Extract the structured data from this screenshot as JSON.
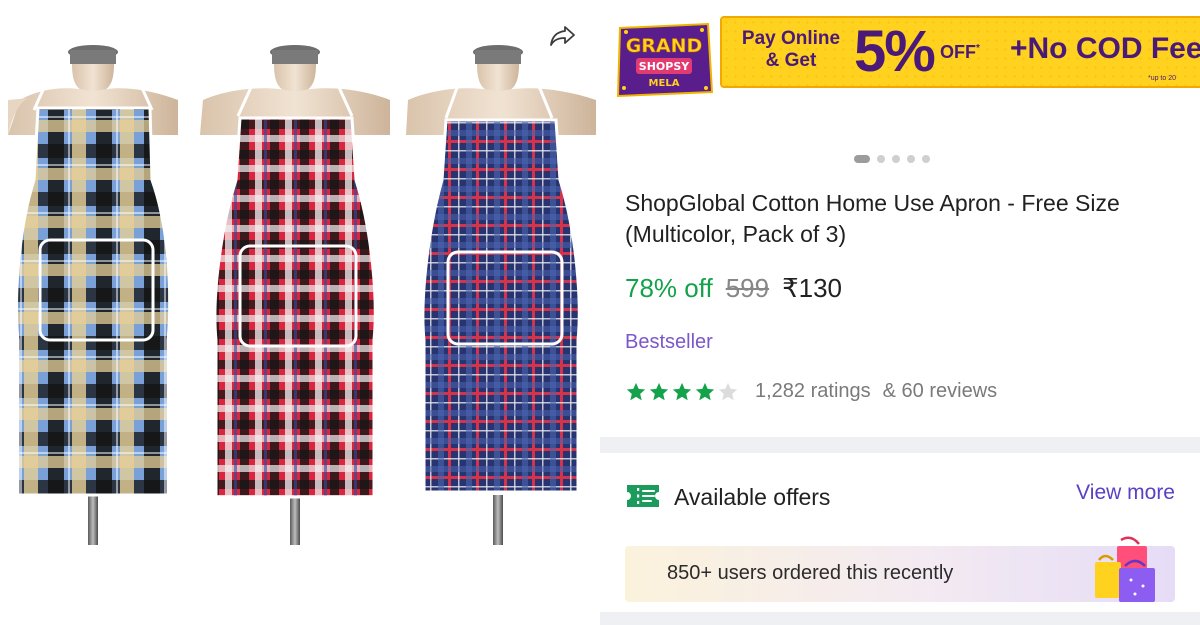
{
  "promo": {
    "logo_line1": "GRAND",
    "logo_line2": "SHOPSY",
    "logo_line3": "MELA",
    "pay_line1": "Pay Online",
    "pay_line2": "& Get",
    "percent": "5%",
    "off": "OFF",
    "off_mark": "*",
    "cod": "+No COD Fee",
    "upto": "*up to 20"
  },
  "carousel": {
    "total": 5,
    "active_index": 0
  },
  "product": {
    "title": "ShopGlobal Cotton Home Use Apron - Free Size (Multicolor, Pack of 3)",
    "discount": "78% off",
    "mrp": "599",
    "price": "₹130",
    "badge": "Bestseller",
    "rating": 4,
    "rating_max": 5,
    "ratings_count": "1,282 ratings",
    "reviews_count": "& 60 reviews"
  },
  "offers": {
    "label": "Available offers",
    "view_more": "View more"
  },
  "social_proof": {
    "text": "850+ users ordered this recently"
  },
  "icons": {
    "share": "share-icon",
    "offers": "offer-ticket-icon",
    "bags": "shopping-bags-icon",
    "star": "star-icon"
  },
  "colors": {
    "discount": "#14a34a",
    "star": "#14a34a",
    "badge": "#7b57c9",
    "link": "#5b3fc4",
    "promo_bg": "#ffd21f",
    "promo_text": "#4a1a78"
  }
}
